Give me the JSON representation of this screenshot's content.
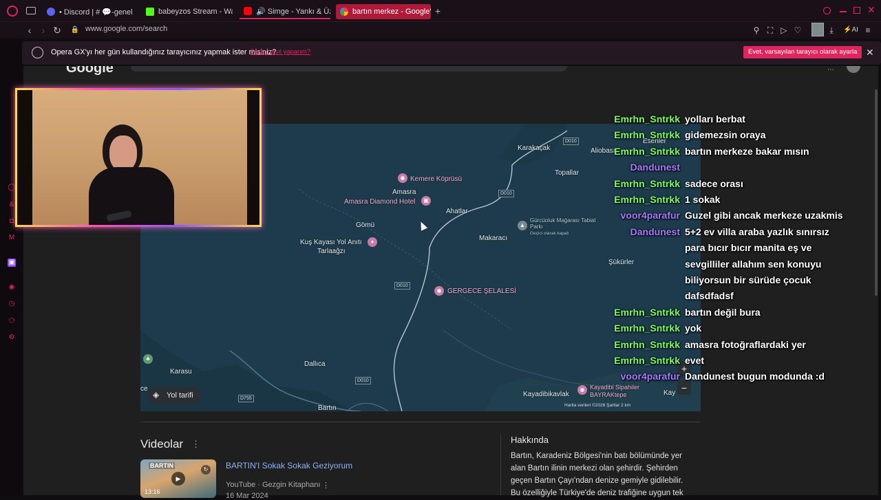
{
  "browser": {
    "tabs": [
      {
        "label": "• Discord | # 💬-genel-so",
        "color": "#5865f2",
        "playing": false,
        "active": false
      },
      {
        "label": "babeyzos Stream - Watch",
        "color": "#53fc18",
        "playing": false,
        "active": false
      },
      {
        "label": "🔊 Simge - Yankı & Üzülm",
        "color": "#ff0000",
        "playing": true,
        "active": false
      },
      {
        "label": "bartın merkez - Google'da",
        "color": "#4285f4",
        "playing": false,
        "active": true
      }
    ],
    "new_tab": "+",
    "url": "www.google.com/search",
    "toolbar_icons": [
      "pin-icon",
      "snapshot-icon",
      "play-icon",
      "heart-icon",
      "avatar",
      "download-icon",
      "ai-icon",
      "menu-icon"
    ],
    "ai_label": "AI",
    "accent": "#e0245e"
  },
  "prompt": {
    "text": "Opera GX'yı her gün kullandığınız tarayıcınız yapmak ister misiniz?",
    "link": "Bunu nasıl yaparım?",
    "accept": "Evet, varsayılan tarayıcı olarak ayarla",
    "close": "✕"
  },
  "google": {
    "logo": "Google"
  },
  "map": {
    "labels": [
      "Karakaçak",
      "Topallar",
      "Esenler",
      "Aliobası",
      "Kemere Köprüsü",
      "Amasra",
      "Amasra Diamond Hotel",
      "Ahatlar",
      "Gömü",
      "Makaracı",
      "Gürcüoluk Mağarası Tabiat Parkı",
      "Geçici olarak kapalı",
      "Kuş Kayası Yol Anıtı",
      "Tarlaağzı",
      "Şükürler",
      "GERGECE ŞELALESİ",
      "Karasu",
      "Dallıca",
      "Kayadibikavlak",
      "Kayadibi Sipahiler BAYRAKtepe",
      "Bartın",
      "Kay",
      "ce"
    ],
    "roads": [
      "D010",
      "D010",
      "D010",
      "D010",
      "D755"
    ],
    "directions": "Yol tarifi",
    "attribution": "Harita verileri ©2026   Şartlar   2 km",
    "zoom_in": "+",
    "zoom_out": "−"
  },
  "videos": {
    "title": "Videolar",
    "more": "⋮",
    "items": [
      {
        "thumb_text": "BARTIN",
        "duration": "13:16",
        "title": "BARTIN'I Sokak Sokak Geziyorum",
        "meta": "YouTube · Gezgin Kitaphanı",
        "date": "16 Mar 2024"
      }
    ]
  },
  "about": {
    "title": "Hakkında",
    "text": "Bartın, Karadeniz Bölgesi'nin batı bölümünde yer alan Bartın ilinin merkezi olan şehirdir. Şehirden geçen Bartın Çayı'ndan denize gemiyle gidilebilir. Bu özelliğiyle Türkiye'de deniz trafiğine uygun tek"
  },
  "chat": [
    {
      "name": "Emrhn_Sntrkk",
      "color": "green",
      "msg": "yolları berbat"
    },
    {
      "name": "Emrhn_Sntrkk",
      "color": "green",
      "msg": "gidemezsin oraya"
    },
    {
      "name": "Emrhn_Sntrkk",
      "color": "green",
      "msg": "bartın merkeze bakar mısın"
    },
    {
      "name": "Dandunest",
      "color": "purple",
      "msg": ""
    },
    {
      "name": "Emrhn_Sntrkk",
      "color": "green",
      "msg": "sadece orası"
    },
    {
      "name": "Emrhn_Sntrkk",
      "color": "green",
      "msg": "1 sokak"
    },
    {
      "name": "voor4parafur",
      "color": "purple",
      "msg": "Guzel gibi ancak merkeze uzakmis"
    },
    {
      "name": "Dandunest",
      "color": "purple",
      "msg": "5+2 ev villa araba yazlık sınırsız"
    },
    {
      "name": "",
      "color": "purple",
      "msg": "para bıcır bıcır manita eş ve"
    },
    {
      "name": "",
      "color": "purple",
      "msg": "sevgilliler allahım sen konuyu"
    },
    {
      "name": "",
      "color": "purple",
      "msg": "biliyorsun bir sürüde çocuk"
    },
    {
      "name": "",
      "color": "purple",
      "msg": "dafsdfadsf"
    },
    {
      "name": "Emrhn_Sntrkk",
      "color": "green",
      "msg": "bartın değil bura"
    },
    {
      "name": "Emrhn_Sntrkk",
      "color": "green",
      "msg": "yok"
    },
    {
      "name": "Emrhn_Sntrkk",
      "color": "green",
      "msg": "amasra fotoğraflardaki yer"
    },
    {
      "name": "Emrhn_Sntrkk",
      "color": "green",
      "msg": "evet"
    },
    {
      "name": "voor4parafur",
      "color": "purple",
      "msg": "Dandunest bugun modunda :d"
    }
  ]
}
